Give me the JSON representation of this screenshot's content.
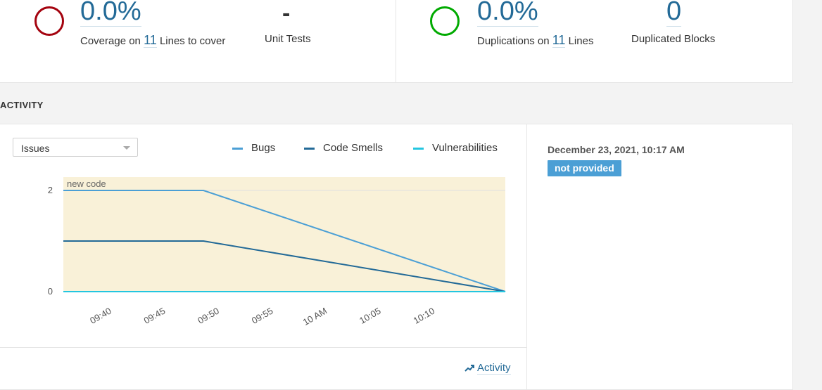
{
  "coverage": {
    "value": "0.0%",
    "label_prefix": "Coverage on",
    "lines_count": "11",
    "label_suffix": "Lines to cover",
    "ring_color": "#a4030f"
  },
  "unit_tests": {
    "value": "-",
    "label": "Unit Tests"
  },
  "duplications": {
    "value": "0.0%",
    "label_prefix": "Duplications on",
    "lines_count": "11",
    "label_suffix": "Lines",
    "ring_color": "#00aa00"
  },
  "duplicated_blocks": {
    "value": "0",
    "label": "Duplicated Blocks"
  },
  "activity": {
    "section_title": "ACTIVITY",
    "graph_select": "Issues",
    "link_label": "Activity",
    "analysis_date": "December 23, 2021, 10:17 AM",
    "badge": "not provided",
    "badge_color": "#4b9fd5"
  },
  "chart_data": {
    "type": "line",
    "annotation": "new code",
    "x_ticks": [
      "09:40",
      "09:45",
      "09:50",
      "09:55",
      "10 AM",
      "10:05",
      "10:10"
    ],
    "y_ticks": [
      "0",
      "2"
    ],
    "ylim": [
      0,
      2
    ],
    "xlim": [
      "09:36",
      "10:17"
    ],
    "x": [
      "09:36",
      "09:49",
      "10:17"
    ],
    "series": [
      {
        "name": "Bugs",
        "color": "#4b9fd5",
        "values": [
          2,
          2,
          0
        ]
      },
      {
        "name": "Code Smells",
        "color": "#236a97",
        "values": [
          1,
          1,
          0
        ]
      },
      {
        "name": "Vulnerabilities",
        "color": "#24c6e0",
        "values": [
          0,
          0,
          0
        ]
      }
    ],
    "grid": true,
    "legend_position": "top-right"
  }
}
